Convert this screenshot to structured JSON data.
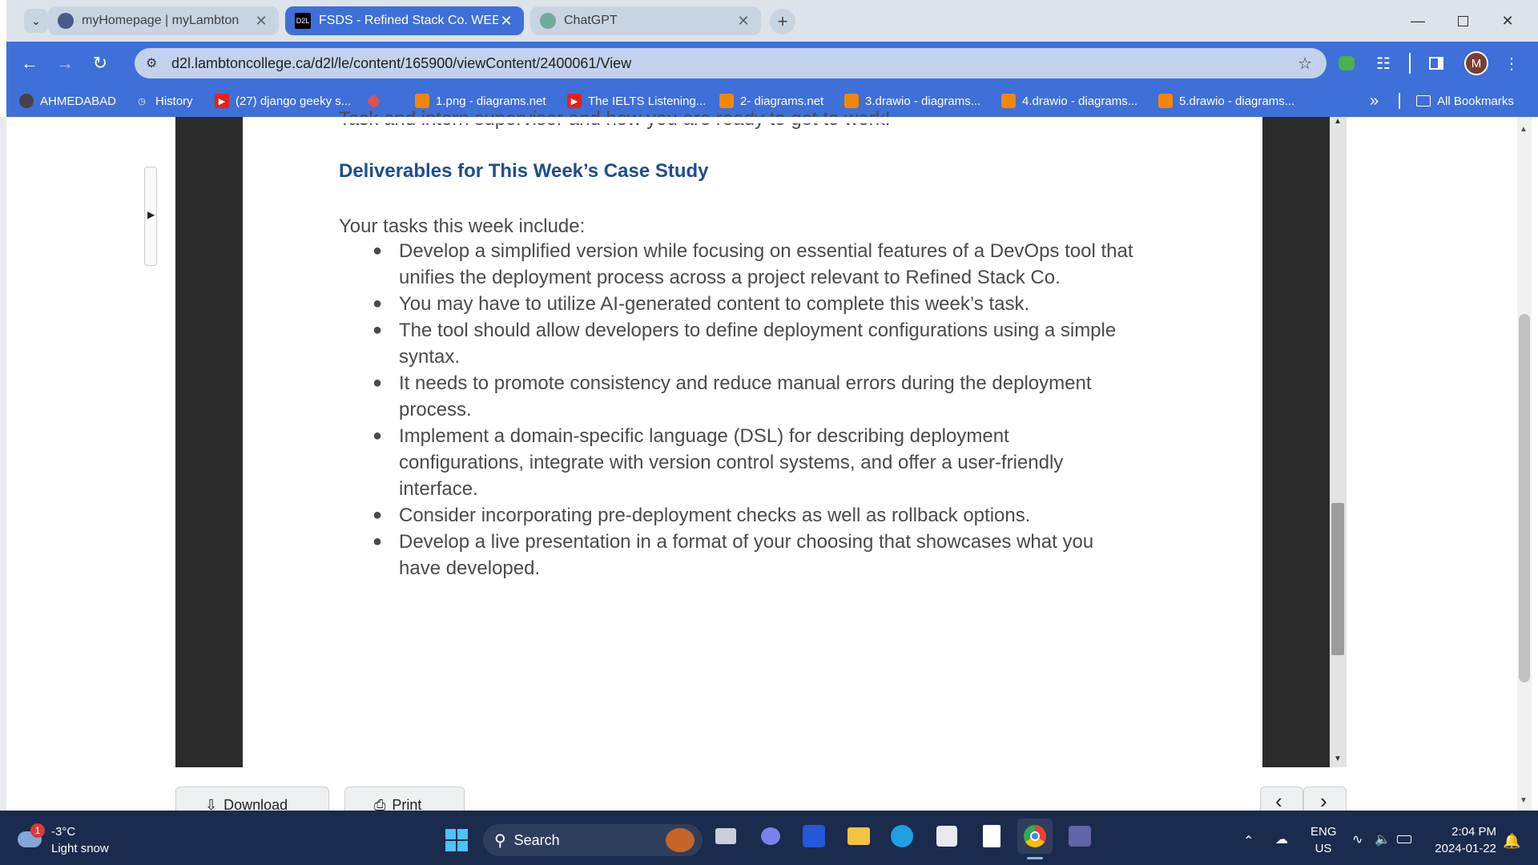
{
  "browser": {
    "tabs": [
      {
        "title": "myHomepage | myLambton",
        "active": false
      },
      {
        "title": "FSDS - Refined Stack Co. WEEK",
        "active": true
      },
      {
        "title": "ChatGPT",
        "active": false
      }
    ],
    "tab_close": "✕",
    "new_tab": "+",
    "url": "d2l.lambtoncollege.ca/d2l/le/content/165900/viewContent/2400061/View",
    "profile_initial": "M",
    "accent_color": "#3f6fd8"
  },
  "bookmarks": {
    "items": [
      {
        "label": "AHMEDABAD",
        "icon": "github-icon"
      },
      {
        "label": "History",
        "icon": "history-icon"
      },
      {
        "label": "(27) django geeky s...",
        "icon": "youtube-icon"
      },
      {
        "label": "",
        "icon": "diamond-icon"
      },
      {
        "label": "1.png - diagrams.net",
        "icon": "drawio-icon"
      },
      {
        "label": "The IELTS Listening...",
        "icon": "youtube-icon"
      },
      {
        "label": "2- diagrams.net",
        "icon": "drawio-icon"
      },
      {
        "label": "3.drawio - diagrams...",
        "icon": "drawio-icon"
      },
      {
        "label": "4.drawio - diagrams...",
        "icon": "drawio-icon"
      },
      {
        "label": "5.drawio - diagrams...",
        "icon": "drawio-icon"
      }
    ],
    "overflow": "»",
    "all_bookmarks": "All Bookmarks"
  },
  "document": {
    "clipped_line": "Task and intern supervisor and how you are ready to get to work!",
    "heading": "Deliverables for This Week’s Case Study",
    "intro": "Your tasks this week include:",
    "bullets": [
      {
        "lines": [
          "Develop a simplified version while focusing on essential features of a DevOps tool that",
          "unifies the deployment process across a project relevant to Refined Stack Co."
        ]
      },
      {
        "lines": [
          "You may have to utilize AI-generated content to complete this week’s task."
        ]
      },
      {
        "lines": [
          "The tool should allow developers to define deployment configurations using a simple",
          "syntax."
        ]
      },
      {
        "lines": [
          "It needs to promote consistency and reduce manual errors during the deployment",
          "process."
        ]
      },
      {
        "lines": [
          "Implement a domain-specific language (DSL) for describing deployment",
          "configurations, integrate with version control systems, and offer a user-friendly",
          "interface."
        ]
      },
      {
        "lines": [
          "Consider incorporating pre-deployment checks as well as rollback options."
        ]
      },
      {
        "lines": [
          "Develop a live presentation in a format of your choosing that showcases what you",
          "have developed."
        ]
      }
    ],
    "heading_color": "#1e4e8c"
  },
  "bottom_bar": {
    "download": "Download",
    "print": "Print",
    "prev": "‹",
    "next": "›"
  },
  "taskbar": {
    "weather_temp": "-3°C",
    "weather_desc": "Light snow",
    "weather_badge": "1",
    "search_label": "Search",
    "lang_top": "ENG",
    "lang_bottom": "US",
    "time": "2:04 PM",
    "date": "2024-01-22"
  }
}
